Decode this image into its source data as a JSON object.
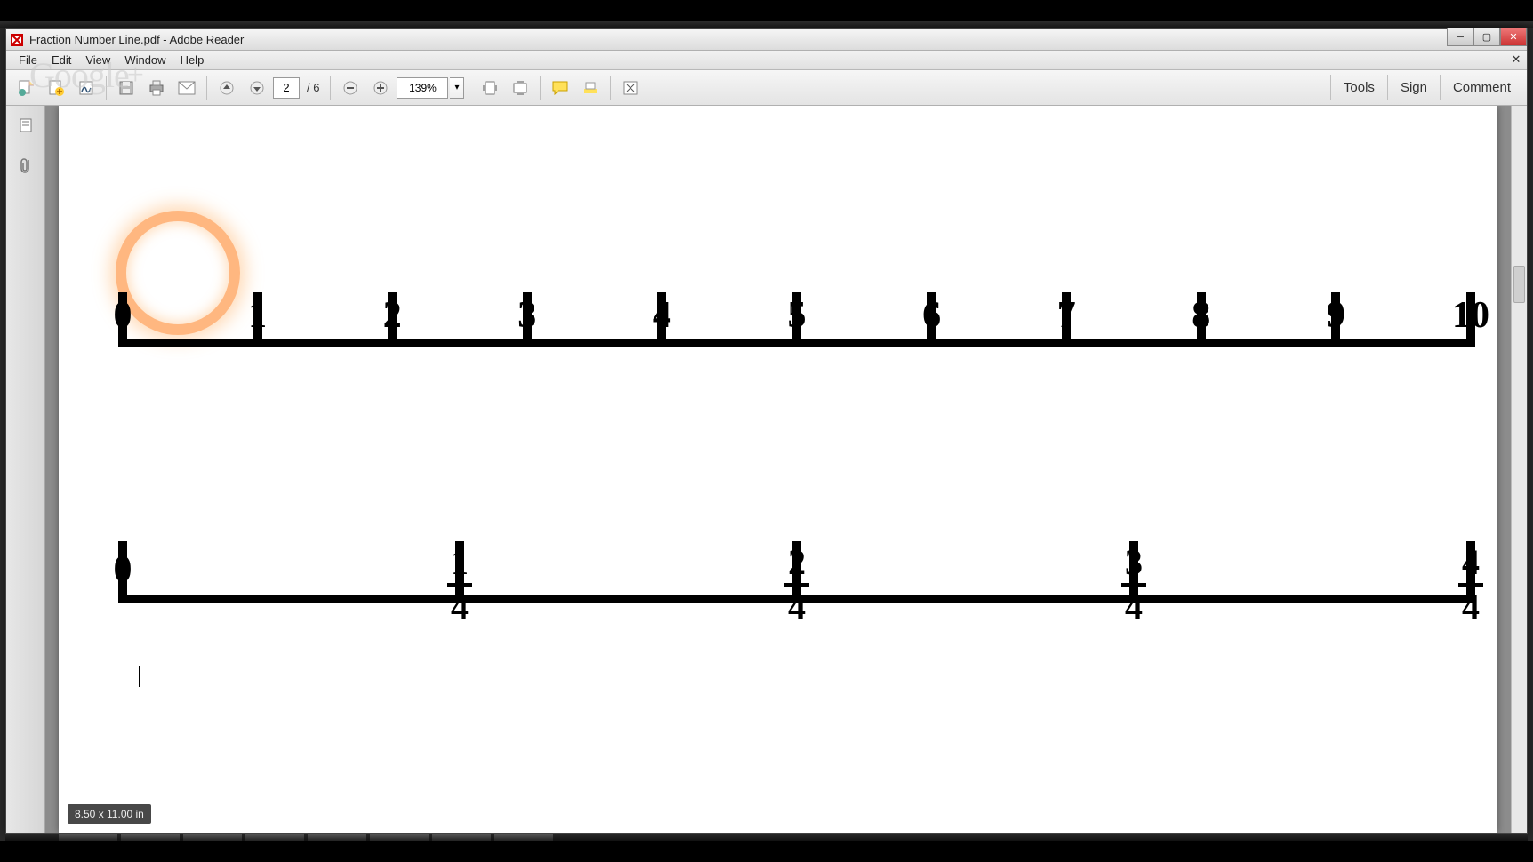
{
  "window": {
    "title": "Fraction Number Line.pdf - Adobe Reader"
  },
  "menubar": {
    "file": "File",
    "edit": "Edit",
    "view": "View",
    "window": "Window",
    "help": "Help"
  },
  "watermark": {
    "text": "Google",
    "plus": "+"
  },
  "toolbar": {
    "page_current": "2",
    "page_sep": "/",
    "page_total": "6",
    "zoom_value": "139%"
  },
  "right_tabs": {
    "tools": "Tools",
    "sign": "Sign",
    "comment": "Comment"
  },
  "status": {
    "page_dimensions": "8.50 x 11.00 in"
  },
  "chart_data": [
    {
      "type": "number_line",
      "id": "line_integers",
      "range": [
        0,
        10
      ],
      "tick_count": 11,
      "labels": [
        "0",
        "1",
        "2",
        "3",
        "4",
        "5",
        "6",
        "7",
        "8",
        "9",
        "10"
      ],
      "highlight": {
        "between": [
          0,
          1
        ],
        "shape": "circle",
        "color": "#ff8c3c"
      }
    },
    {
      "type": "number_line",
      "id": "line_quarters",
      "range": [
        0,
        1
      ],
      "tick_count": 5,
      "labels": [
        "0",
        "1/4",
        "2/4",
        "3/4",
        "4/4"
      ],
      "labels_detail": [
        {
          "display": "0",
          "numerator": null,
          "denominator": null
        },
        {
          "display": "1/4",
          "numerator": "1",
          "denominator": "4"
        },
        {
          "display": "2/4",
          "numerator": "2",
          "denominator": "4"
        },
        {
          "display": "3/4",
          "numerator": "3",
          "denominator": "4"
        },
        {
          "display": "4/4",
          "numerator": "4",
          "denominator": "4"
        }
      ]
    }
  ]
}
